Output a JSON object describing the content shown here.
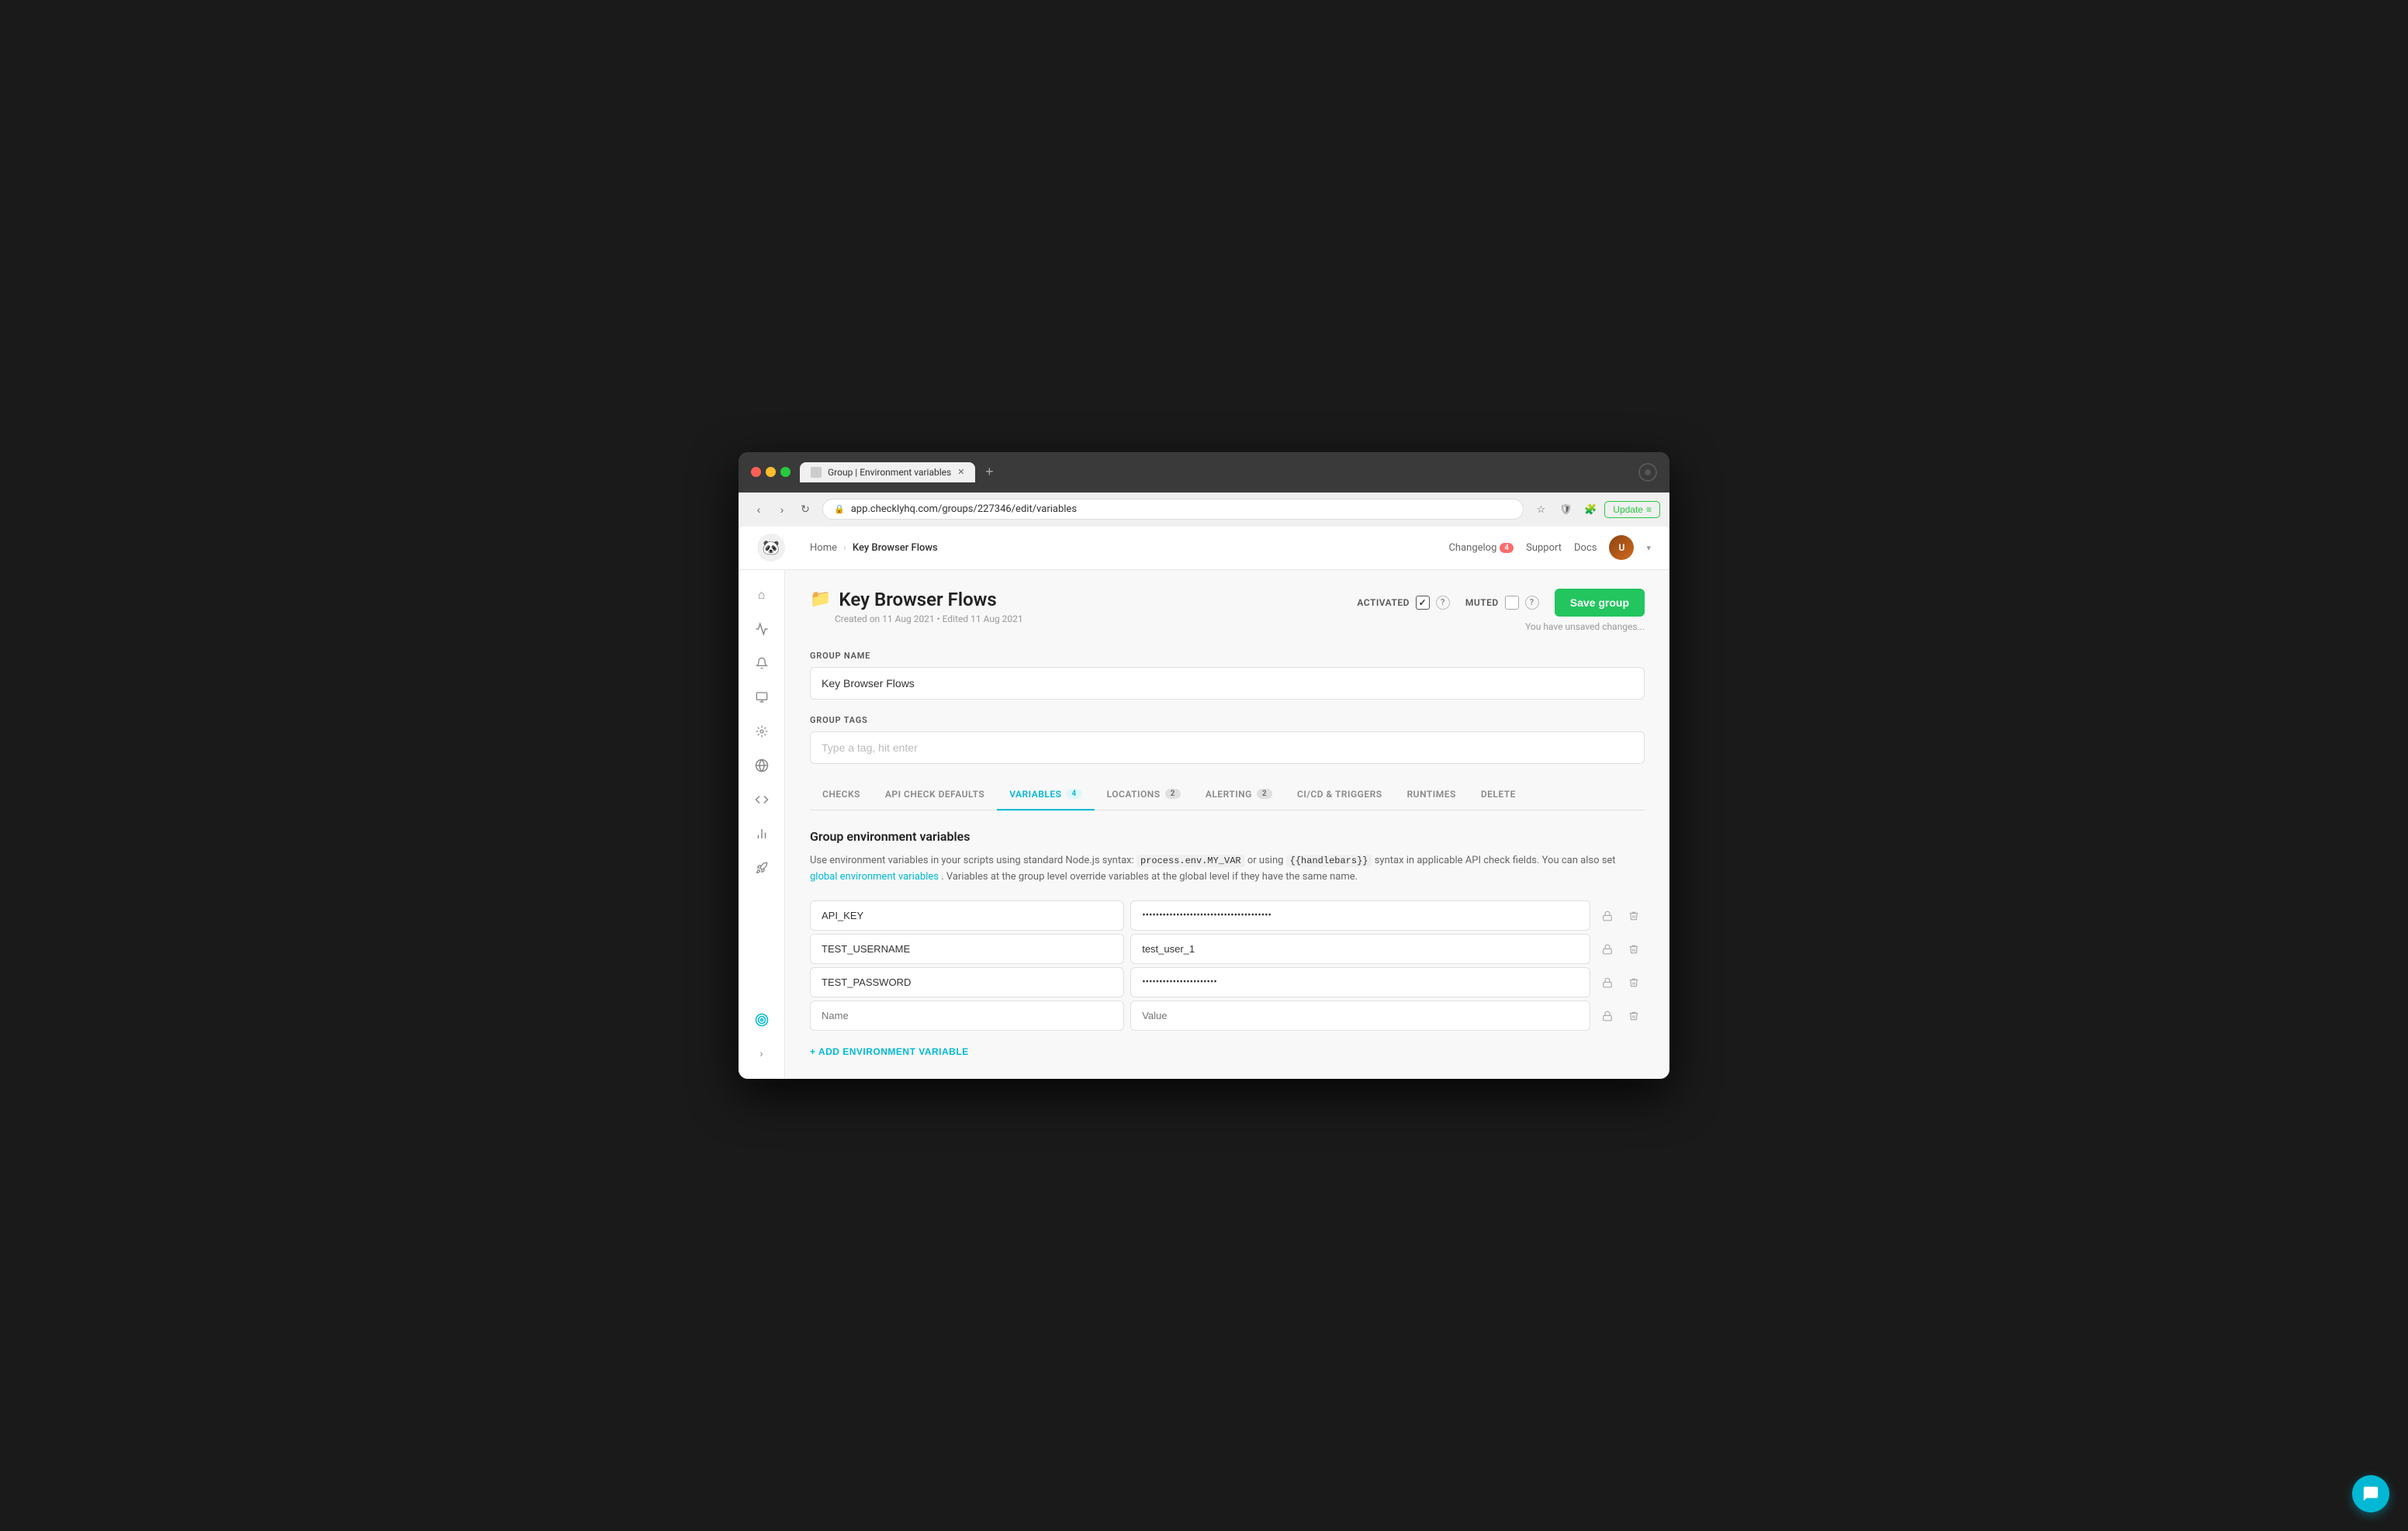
{
  "browser": {
    "tab_title": "Group | Environment variables",
    "url": "app.checklyhq.com/groups/227346/edit/variables",
    "nav_back": "‹",
    "nav_forward": "›",
    "nav_refresh": "↻",
    "new_tab": "+",
    "update_label": "Update"
  },
  "header": {
    "breadcrumb_home": "Home",
    "breadcrumb_separator": "›",
    "breadcrumb_current": "Key Browser Flows",
    "changelog_label": "Changelog",
    "changelog_count": "4",
    "support_label": "Support",
    "docs_label": "Docs"
  },
  "sidebar": {
    "items": [
      {
        "icon": "⌂",
        "name": "home"
      },
      {
        "icon": "∿",
        "name": "activity"
      },
      {
        "icon": "🔔",
        "name": "alerts"
      },
      {
        "icon": "🖥",
        "name": "monitors"
      },
      {
        "icon": "⚡",
        "name": "sensors"
      },
      {
        "icon": "◎",
        "name": "globe"
      },
      {
        "icon": "</>",
        "name": "code"
      },
      {
        "icon": "↗",
        "name": "chart"
      },
      {
        "icon": "🚀",
        "name": "rocket"
      },
      {
        "icon": "◎",
        "name": "target"
      }
    ],
    "expand_icon": "›"
  },
  "page": {
    "title": "Key Browser Flows",
    "folder_icon": "📁",
    "meta": "Created on 11 Aug 2021 • Edited 11 Aug 2021",
    "activated_label": "ACTIVATED",
    "muted_label": "MUTED",
    "save_button": "Save group",
    "unsaved_text": "You have unsaved changes..."
  },
  "form": {
    "group_name_label": "GROUP NAME",
    "group_name_value": "Key Browser Flows",
    "group_tags_label": "GROUP TAGS",
    "group_tags_placeholder": "Type a tag, hit enter"
  },
  "tabs": [
    {
      "id": "checks",
      "label": "CHECKS",
      "badge": null,
      "active": false
    },
    {
      "id": "api-check-defaults",
      "label": "API CHECK DEFAULTS",
      "badge": null,
      "active": false
    },
    {
      "id": "variables",
      "label": "VARIABLES",
      "badge": "4",
      "active": true
    },
    {
      "id": "locations",
      "label": "LOCATIONS",
      "badge": "2",
      "active": false
    },
    {
      "id": "alerting",
      "label": "ALERTING",
      "badge": "2",
      "active": false
    },
    {
      "id": "cicd",
      "label": "CI/CD & TRIGGERS",
      "badge": null,
      "active": false
    },
    {
      "id": "runtimes",
      "label": "RUNTIMES",
      "badge": null,
      "active": false
    },
    {
      "id": "delete",
      "label": "DELETE",
      "badge": null,
      "active": false
    }
  ],
  "variables_section": {
    "title": "Group environment variables",
    "description_part1": "Use environment variables in your scripts using standard Node.js syntax:",
    "code1": "process.env.MY_VAR",
    "description_part2": "or using",
    "code2": "{{handlebars}}",
    "description_part3": "syntax in applicable API check fields. You can also set",
    "link_text": "global environment variables",
    "description_part4": ". Variables at the group level override variables at the global level if they have the same name.",
    "add_button": "+ ADD ENVIRONMENT VARIABLE",
    "env_vars": [
      {
        "name": "API_KEY",
        "value": "••••••••••••••••••••••••••••••••••••••",
        "masked": true,
        "placeholder_name": "",
        "placeholder_value": ""
      },
      {
        "name": "TEST_USERNAME",
        "value": "test_user_1",
        "masked": false,
        "placeholder_name": "",
        "placeholder_value": ""
      },
      {
        "name": "TEST_PASSWORD",
        "value": "••••••••••••••••••••••",
        "masked": true,
        "placeholder_name": "",
        "placeholder_value": ""
      },
      {
        "name": "",
        "value": "",
        "masked": false,
        "placeholder_name": "Name",
        "placeholder_value": "Value"
      }
    ]
  },
  "chat": {
    "icon": "💬"
  }
}
